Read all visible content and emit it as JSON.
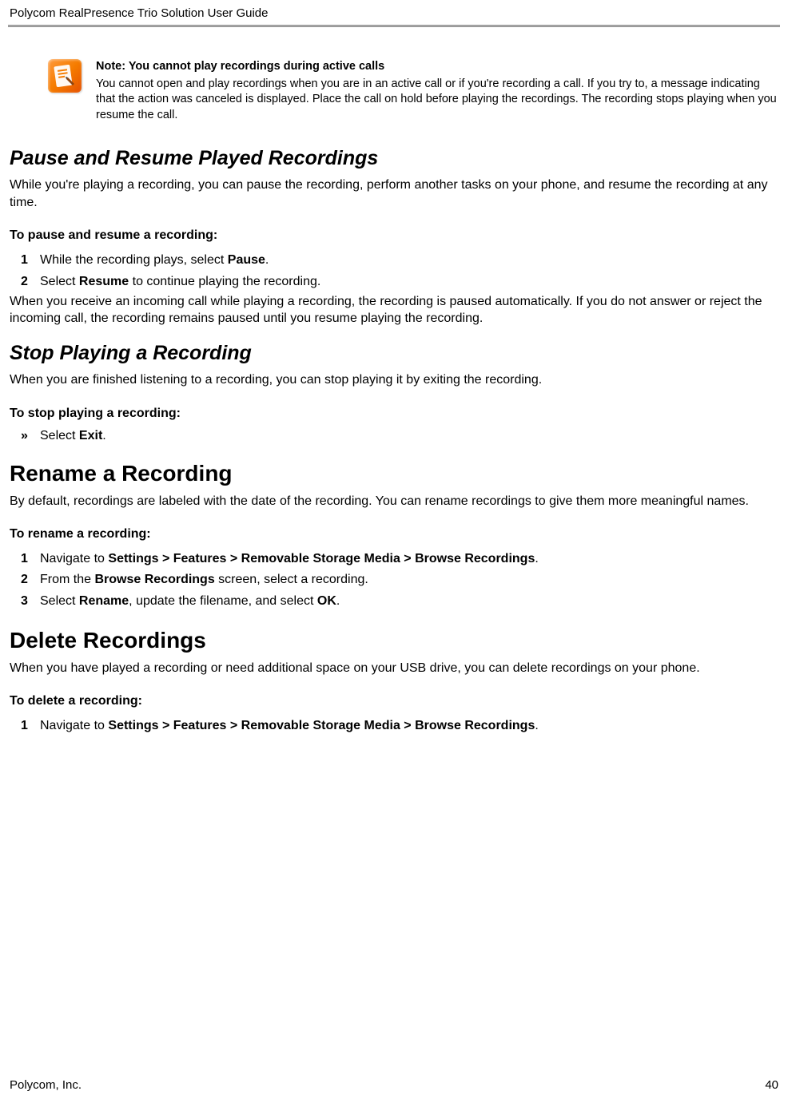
{
  "header": {
    "title": "Polycom RealPresence Trio Solution User Guide"
  },
  "note": {
    "title": "Note: You cannot play recordings during active calls",
    "body": "You cannot open and play recordings when you are in an active call or if you're recording a call. If you try to, a message indicating that the action was canceled is displayed. Place the call on hold before playing the recordings. The recording stops playing when you resume the call."
  },
  "pauseResume": {
    "heading": "Pause and Resume Played Recordings",
    "intro": "While you're playing a recording, you can pause the recording, perform another tasks on your phone, and resume the recording at any time.",
    "taskHeading": "To pause and resume a recording:",
    "step1_pre": "While the recording plays, select ",
    "step1_bold": "Pause",
    "step1_post": ".",
    "step2_pre": "Select ",
    "step2_bold": "Resume",
    "step2_post": " to continue playing the recording.",
    "after": "When you receive an incoming call while playing a recording, the recording is paused automatically. If you do not answer or reject the incoming call, the recording remains paused until you resume playing the recording."
  },
  "stopPlaying": {
    "heading": "Stop Playing a Recording",
    "intro": "When you are finished listening to a recording, you can stop playing it by exiting the recording.",
    "taskHeading": "To stop playing a recording:",
    "bullet_pre": "Select ",
    "bullet_bold": "Exit",
    "bullet_post": "."
  },
  "rename": {
    "heading": "Rename a Recording",
    "intro": "By default, recordings are labeled with the date of the recording. You can rename recordings to give them more meaningful names.",
    "taskHeading": "To rename a recording:",
    "step1_pre": "Navigate to ",
    "step1_bold": "Settings > Features > Removable Storage Media > Browse Recordings",
    "step1_post": ".",
    "step2_pre": "From the ",
    "step2_bold": "Browse Recordings",
    "step2_post": " screen, select a recording.",
    "step3_pre": "Select ",
    "step3_bold1": "Rename",
    "step3_mid": ", update the filename, and select ",
    "step3_bold2": "OK",
    "step3_post": "."
  },
  "delete": {
    "heading": "Delete Recordings",
    "intro": "When you have played a recording or need additional space on your USB drive, you can delete recordings on your phone.",
    "taskHeading": "To delete a recording:",
    "step1_pre": "Navigate to ",
    "step1_bold": "Settings > Features > Removable Storage Media > Browse Recordings",
    "step1_post": "."
  },
  "footer": {
    "company": "Polycom, Inc.",
    "page": "40"
  },
  "numbers": {
    "n1": "1",
    "n2": "2",
    "n3": "3"
  },
  "bullet": "»"
}
